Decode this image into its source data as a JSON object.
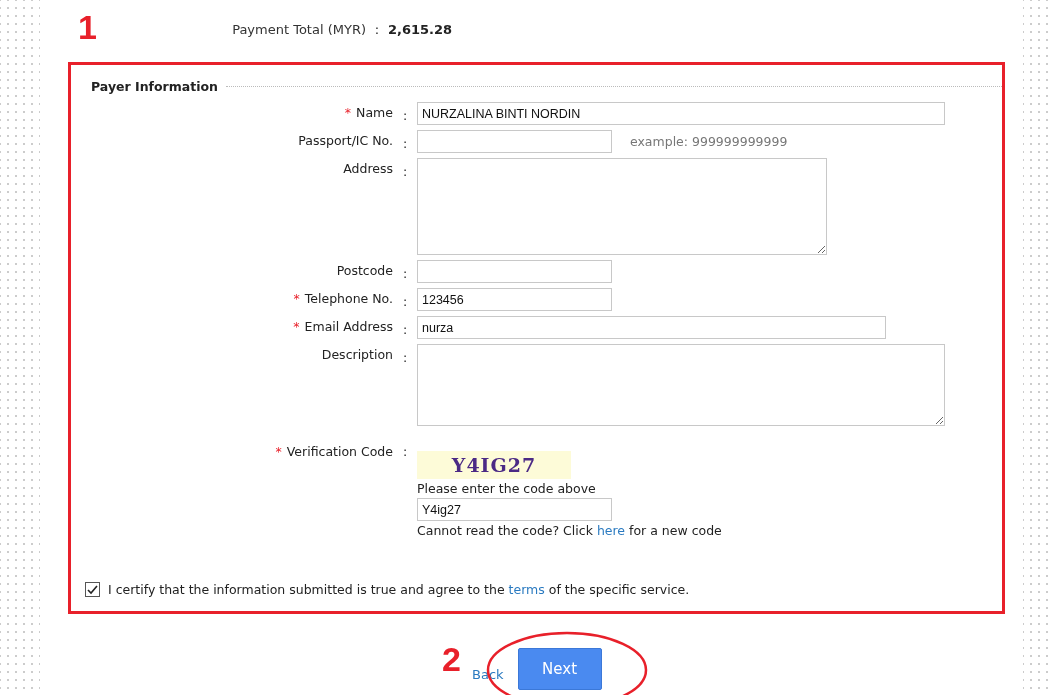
{
  "payment_total": {
    "label": "Payment Total (MYR)",
    "separator": ":",
    "value": "2,615.28"
  },
  "annotations": [
    {
      "kind": "box",
      "label": "1"
    },
    {
      "kind": "ellipse",
      "label": "2"
    }
  ],
  "payer_information": {
    "legend": "Payer Information",
    "fields": [
      {
        "kind": "input",
        "required_mark": "*",
        "label": "Name",
        "separator": ":",
        "value": "NURZALINA BINTI NORDIN"
      },
      {
        "kind": "input",
        "label": "Passport/IC No.",
        "separator": ":",
        "hint": "example: 999999999999"
      },
      {
        "kind": "textarea",
        "label": "Address",
        "separator": ":"
      },
      {
        "kind": "input",
        "label": "Postcode",
        "separator": ":"
      },
      {
        "kind": "input",
        "required_mark": "*",
        "label": "Telephone No.",
        "separator": ":",
        "value": "123456"
      },
      {
        "kind": "input",
        "required_mark": "*",
        "label": "Email Address",
        "separator": ":",
        "value": "nurza"
      },
      {
        "kind": "textarea",
        "label": "Description",
        "separator": ":"
      },
      {
        "kind": "captcha",
        "required_mark": "*",
        "label": "Verification Code",
        "separator": ":",
        "captcha": "Y4IG27",
        "instruction": "Please enter the code above",
        "value": "Y4ig27",
        "refresh": {
          "before": "Cannot read the code? Click ",
          "link": "here",
          "after": " for a new code"
        }
      }
    ],
    "certify": {
      "checked": true,
      "before": "I certify that the information submitted is true and agree to the ",
      "link": "terms",
      "after": " of the specific service."
    }
  },
  "actions": {
    "back": "Back",
    "next": "Next"
  }
}
